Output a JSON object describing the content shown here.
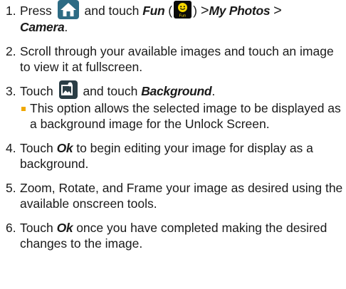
{
  "steps": [
    {
      "num": "1.",
      "t1": "Press",
      "t2": "and touch",
      "fun": "Fun",
      "paren_open": "(",
      "paren_close": ")",
      "gt1": ">",
      "myphotos": "My Photos",
      "gt2": ">",
      "camera": "Camera",
      "period": "."
    },
    {
      "num": "2.",
      "text": "Scroll through your available images and touch an image to view it at fullscreen."
    },
    {
      "num": "3.",
      "t1": "Touch",
      "t2": "and touch",
      "background": "Background",
      "period": ".",
      "sub": "This option allows the selected image to be displayed as a background image for the Unlock Screen."
    },
    {
      "num": "4.",
      "t1": "Touch",
      "ok": "Ok",
      "t2": "to begin editing your image for display as a background."
    },
    {
      "num": "5.",
      "text": "Zoom, Rotate, and Frame your image as desired using the available onscreen tools."
    },
    {
      "num": "6.",
      "t1": "Touch",
      "ok": "Ok",
      "t2": "once you have completed making the desired changes to the image."
    }
  ],
  "icons": {
    "home": "home-icon",
    "fun": "fun-smiley-icon",
    "gallery": "gallery-icon",
    "fun_label": "Fun"
  },
  "colors": {
    "home_bg": "#2d6b84",
    "bullet": "#f0a800",
    "smiley": "#f6d600"
  }
}
